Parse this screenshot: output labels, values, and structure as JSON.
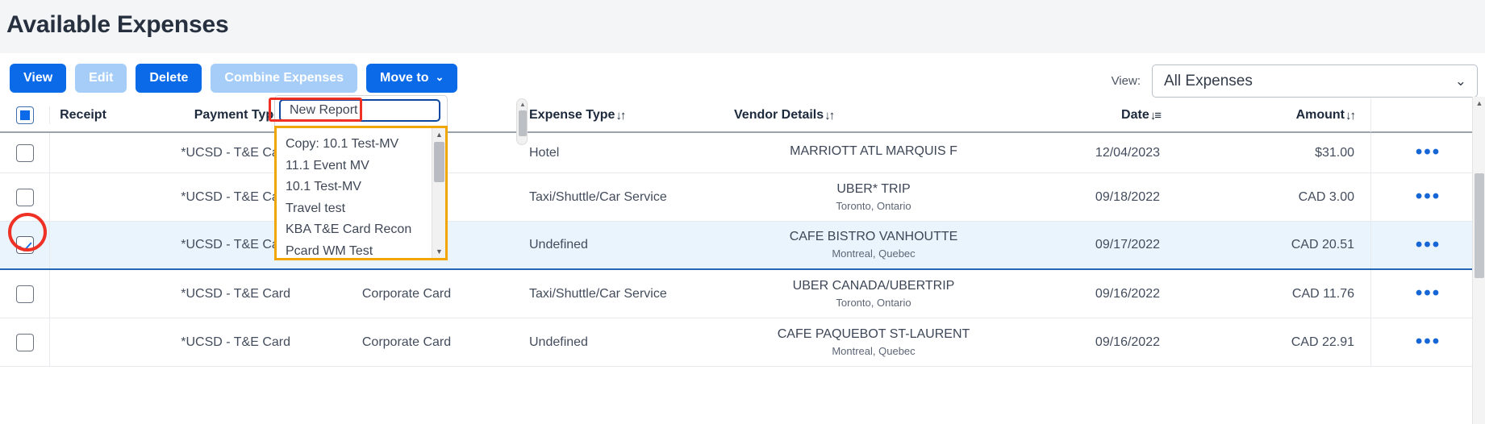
{
  "page": {
    "title": "Available Expenses"
  },
  "toolbar": {
    "buttons": [
      {
        "label": "View",
        "style": "primary"
      },
      {
        "label": "Edit",
        "style": "muted"
      },
      {
        "label": "Delete",
        "style": "primary"
      },
      {
        "label": "Combine Expenses",
        "style": "muted"
      },
      {
        "label": "Move to",
        "style": "primary",
        "caret": "⌄"
      }
    ]
  },
  "view_selector": {
    "label": "View:",
    "value": "All Expenses",
    "chevron": "⌄"
  },
  "move_to_dropdown": {
    "new_report_label": "New Report",
    "items": [
      "Copy: 10.1 Test-MV",
      "11.1 Event MV",
      "10.1 Test-MV",
      "Travel test",
      "KBA T&E Card Recon",
      "Pcard WM Test"
    ],
    "scroll_up_arrow": "▲",
    "scroll_down_arrow": "▼",
    "highlight_color": "#ee3124",
    "list_border_color": "#f0a500"
  },
  "table": {
    "columns": [
      {
        "key": "receipt",
        "label": "Receipt",
        "sort": ""
      },
      {
        "key": "payment",
        "label": "Payment Type",
        "sort": "↓↑"
      },
      {
        "key": "card",
        "label": "",
        "sort": ""
      },
      {
        "key": "etype",
        "label": "Expense Type",
        "sort": "↓↑"
      },
      {
        "key": "vendor",
        "label": "Vendor Details",
        "sort": "↓↑"
      },
      {
        "key": "date",
        "label": "Date",
        "sort": "↓≡"
      },
      {
        "key": "amount",
        "label": "Amount",
        "sort": "↓↑"
      }
    ],
    "header_checkbox_state": "indeterminate",
    "rows": [
      {
        "checked": false,
        "selected": false,
        "payment_type": "*UCSD - T&E Card",
        "card_label": "",
        "expense_type": "Hotel",
        "vendor": "MARRIOTT ATL MARQUIS F",
        "vendor_location": "",
        "date": "12/04/2023",
        "amount": "$31.00",
        "more": "•••"
      },
      {
        "checked": false,
        "selected": false,
        "payment_type": "*UCSD - T&E Card",
        "card_label": "",
        "expense_type": "Taxi/Shuttle/Car Service",
        "vendor": "UBER* TRIP",
        "vendor_location": "Toronto, Ontario",
        "date": "09/18/2022",
        "amount": "CAD 3.00",
        "more": "•••"
      },
      {
        "checked": true,
        "selected": true,
        "payment_type": "*UCSD - T&E Card",
        "card_label": "",
        "expense_type": "Undefined",
        "vendor": "CAFE BISTRO VANHOUTTE",
        "vendor_location": "Montreal, Quebec",
        "date": "09/17/2022",
        "amount": "CAD 20.51",
        "more": "•••"
      },
      {
        "checked": false,
        "selected": false,
        "payment_type": "*UCSD - T&E Card",
        "card_label": "Corporate Card",
        "expense_type": "Taxi/Shuttle/Car Service",
        "vendor": "UBER CANADA/UBERTRIP",
        "vendor_location": "Toronto, Ontario",
        "date": "09/16/2022",
        "amount": "CAD 11.76",
        "more": "•••"
      },
      {
        "checked": false,
        "selected": false,
        "payment_type": "*UCSD - T&E Card",
        "card_label": "Corporate Card",
        "expense_type": "Undefined",
        "vendor": "CAFE PAQUEBOT ST-LAURENT",
        "vendor_location": "Montreal, Quebec",
        "date": "09/16/2022",
        "amount": "CAD 22.91",
        "more": "•••"
      }
    ]
  },
  "colors": {
    "accent_blue": "#0b6ae8",
    "muted_blue": "#a6cdf7",
    "selected_row": "#e9f4fd",
    "annotation_red": "#ee3124",
    "annotation_orange": "#f0a500"
  }
}
